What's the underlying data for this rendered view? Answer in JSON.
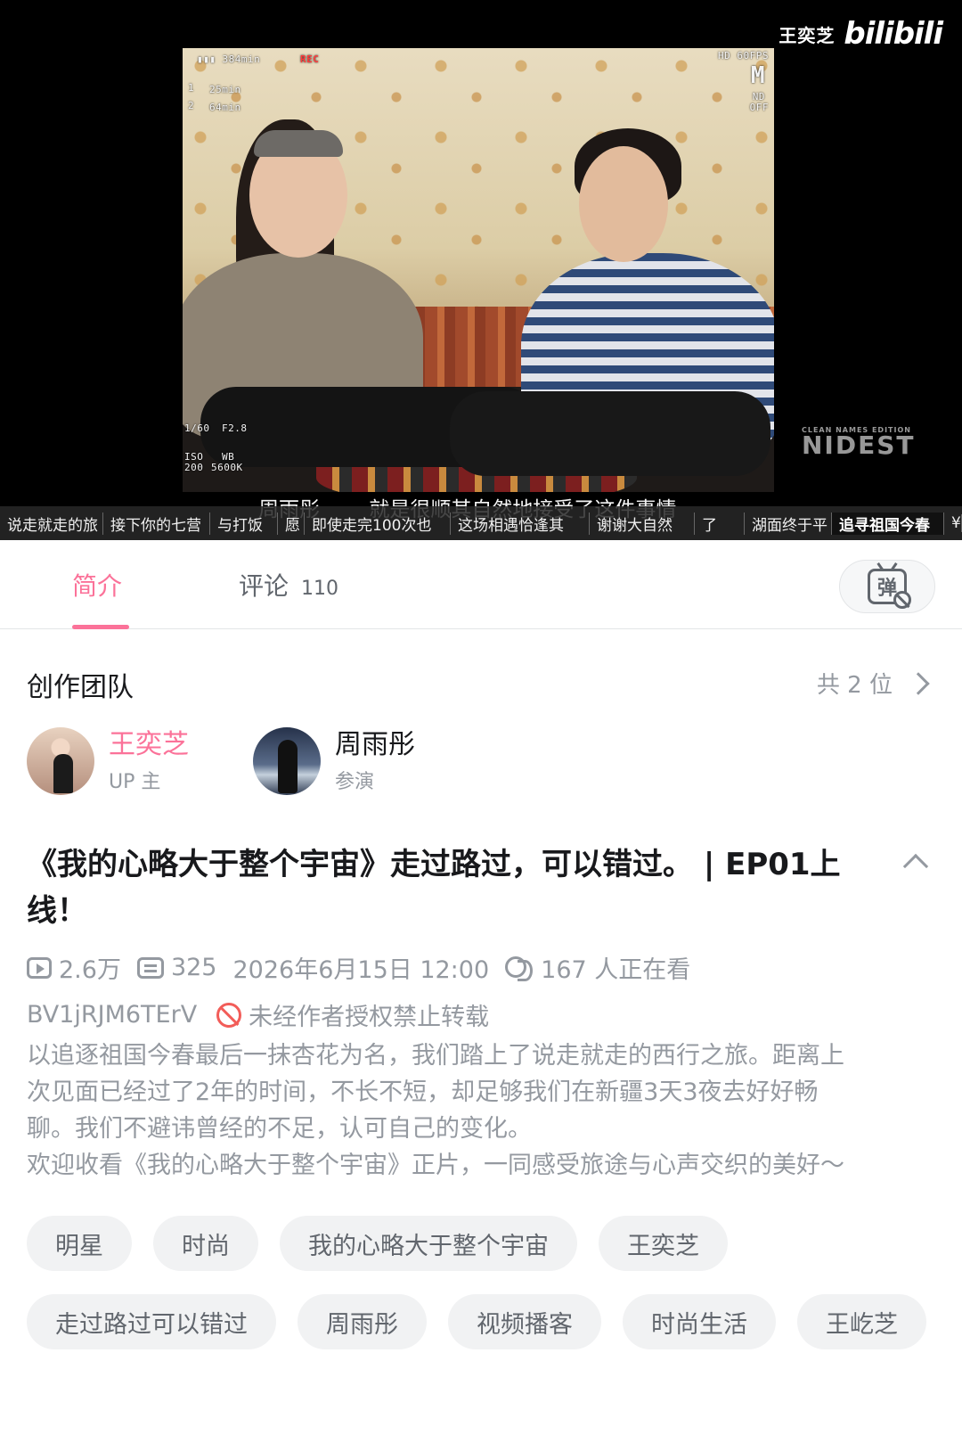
{
  "video": {
    "watermark_name": "王奕芝",
    "watermark_logo": "bilibili",
    "hud": {
      "battery": "▮▮▮ 384min",
      "rec": "REC",
      "track1_index": "1",
      "track1": "25min",
      "track2_index": "2",
      "track2": "64min",
      "fps": "HD 60FPS",
      "mode": "M",
      "nd1": "ND",
      "nd2": "OFF",
      "shutter": "1/60",
      "aperture": "F2.8",
      "iso_label": "ISO",
      "iso": "200",
      "wb_label": "WB",
      "wb": "5600K"
    },
    "logo2_small": "CLEAN NAMES EDITION",
    "logo2_text": "NIDEST",
    "subtitle_speaker": "周雨彤",
    "subtitle_text": "就是很顺其自然地接受了这件事情",
    "danmaku": [
      "说走就走的旅",
      "接下你的七营",
      "与打饭",
      "愿",
      "即使走完100次也",
      "这场相遇恰逢其",
      "谢谢大自然",
      "了",
      "湖面终于平",
      "追寻祖国今春",
      "¥"
    ]
  },
  "tabs": {
    "intro": "简介",
    "comments": "评论",
    "comments_count": "110",
    "danmaku_toggle_glyph": "弹"
  },
  "team": {
    "title": "创作团队",
    "count": "共 2 位",
    "members": [
      {
        "name": "王奕芝",
        "role": "UP 主"
      },
      {
        "name": "周雨彤",
        "role": "参演"
      }
    ]
  },
  "detail": {
    "title": "《我的心略大于整个宇宙》走过路过，可以错过。 | EP01上线！",
    "views": "2.6万",
    "danmaku_count": "325",
    "publish_time": "2026年6月15日 12:00",
    "watching": "167 人正在看",
    "bvid": "BV1jRJM6TErV",
    "copyright": "未经作者授权禁止转载",
    "description": [
      "以追逐祖国今春最后一抹杏花为名，我们踏上了说走就走的西行之旅。距离上",
      "次见面已经过了2年的时间，不长不短，却足够我们在新疆3天3夜去好好畅",
      "聊。我们不避讳曾经的不足，认可自己的变化。",
      "欢迎收看《我的心略大于整个宇宙》正片，一同感受旅途与心声交织的美好～"
    ],
    "tags": [
      "明星",
      "时尚",
      "我的心略大于整个宇宙",
      "王奕芝",
      "走过路过可以错过",
      "周雨彤",
      "视频播客",
      "时尚生活",
      "王屹芝"
    ]
  },
  "colors": {
    "accent": "#fb7299",
    "text": "#18191c",
    "muted": "#9499a0",
    "tag_bg": "#f1f2f3",
    "warning": "#f25d59"
  }
}
